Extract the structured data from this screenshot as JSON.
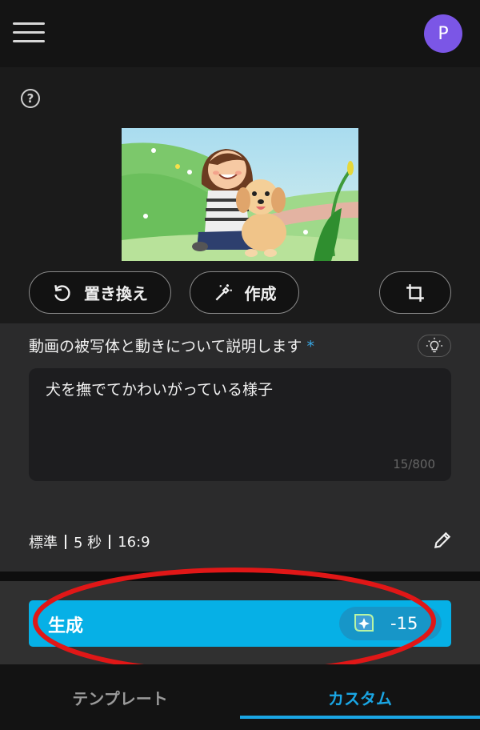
{
  "header": {
    "avatar_initial": "P",
    "help_glyph": "?"
  },
  "media": {
    "preview_alt": "dog-and-girl-illustration"
  },
  "actions": {
    "replace_label": "置き換え",
    "create_label": "作成"
  },
  "prompt": {
    "label": "動画の被写体と動きについて説明します",
    "required_mark": "*",
    "value": "犬を撫でてかわいがっている様子",
    "counter": "15/800"
  },
  "settings": {
    "quality": "標準",
    "duration": "5 秒",
    "ratio": "16:9"
  },
  "generate": {
    "label": "生成",
    "credit_cost": "-15"
  },
  "tabs": [
    {
      "label": "テンプレート"
    },
    {
      "label": "カスタム"
    }
  ],
  "colors": {
    "accent": "#06b0e6",
    "avatar": "#7b56e6",
    "annotation": "#e01717"
  }
}
